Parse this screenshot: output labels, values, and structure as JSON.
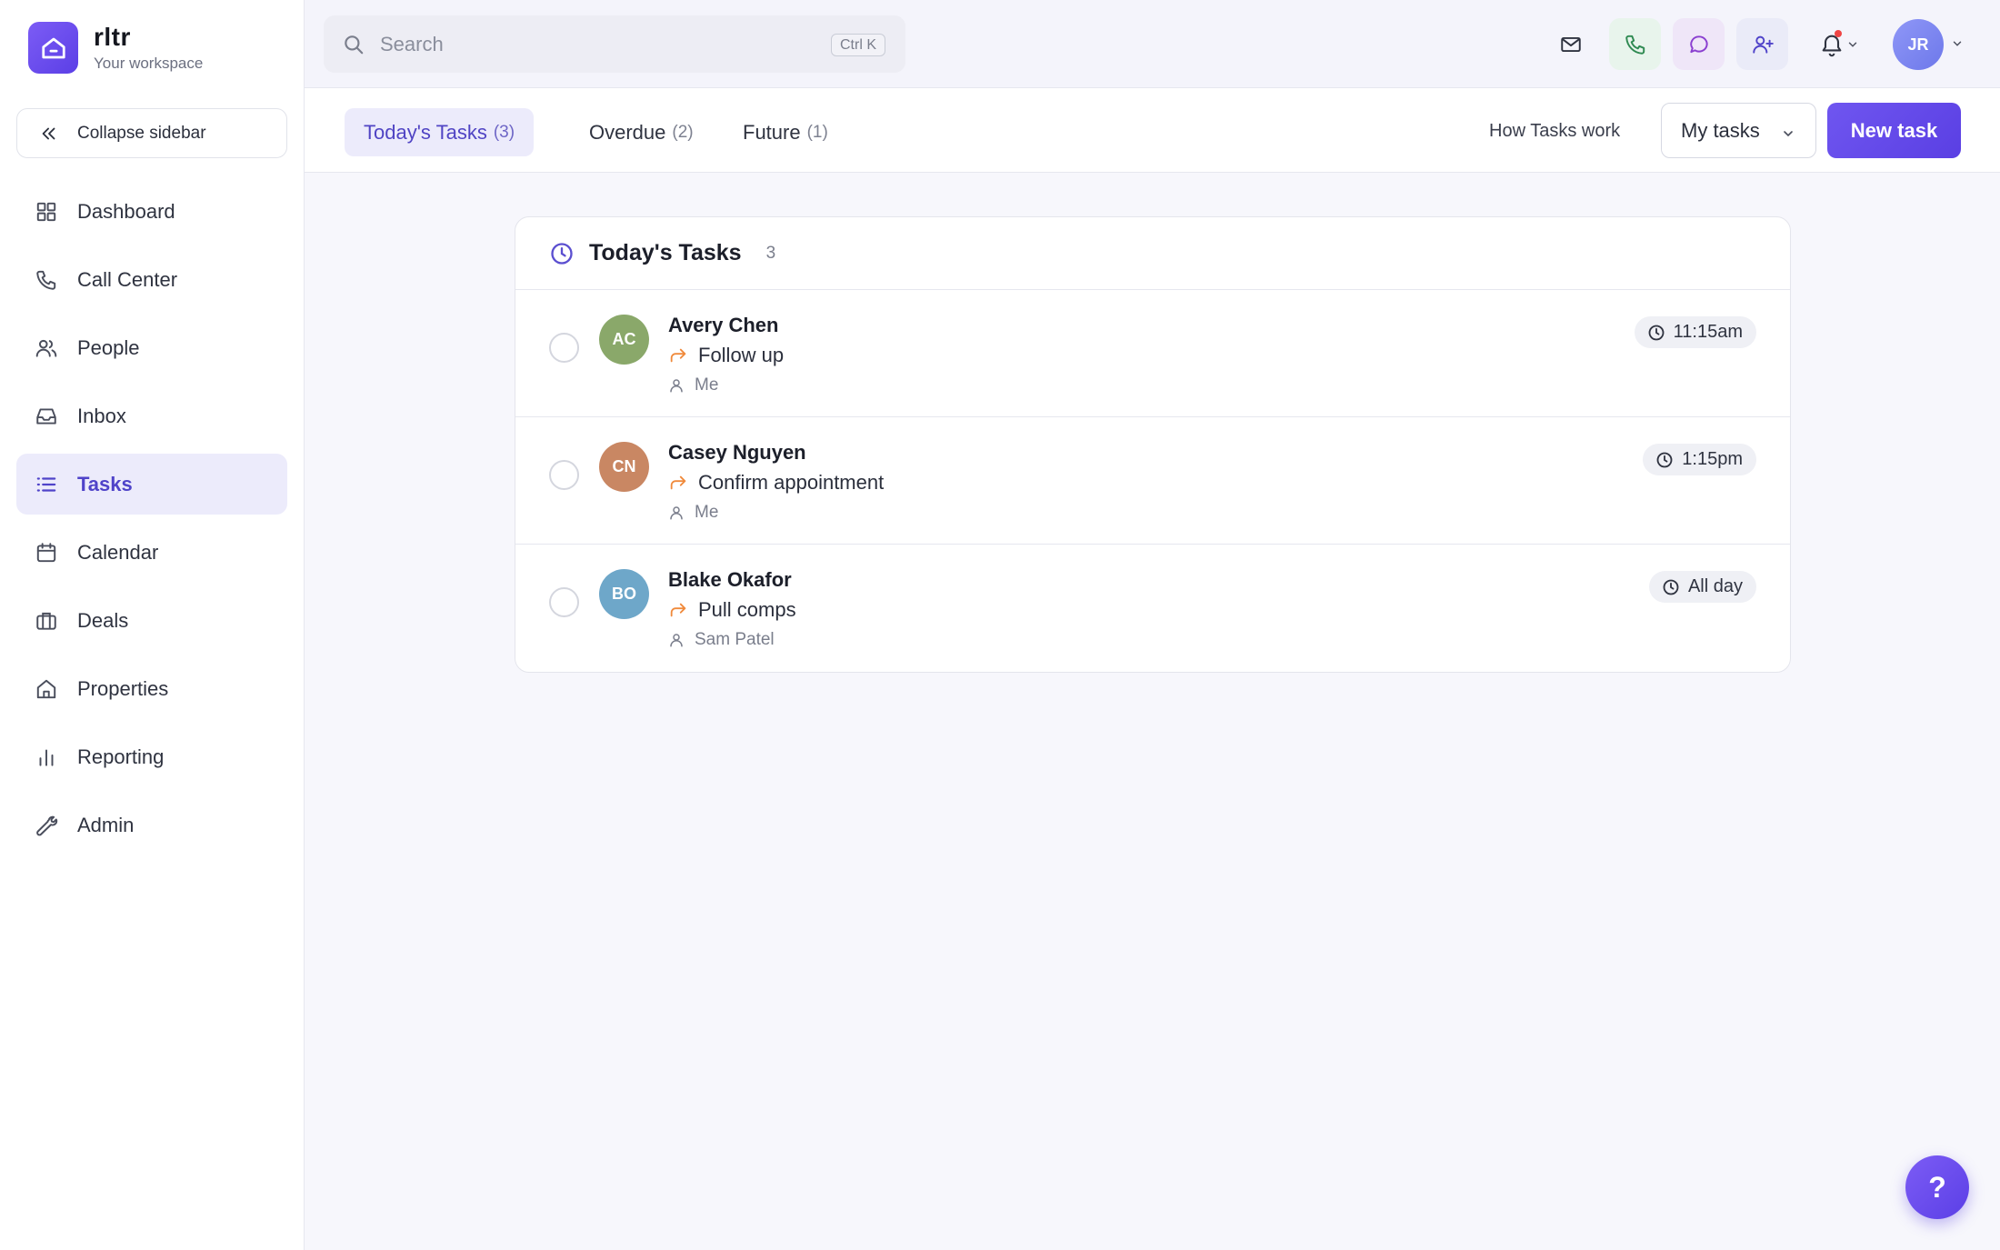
{
  "brand": {
    "name": "rltr",
    "subtitle": "Your workspace",
    "logo_icon": "house-icon"
  },
  "sidebar": {
    "collapse_label": "Collapse sidebar",
    "items": [
      {
        "label": "Dashboard",
        "icon": "grid-icon",
        "active": false
      },
      {
        "label": "Call Center",
        "icon": "phone-icon",
        "active": false
      },
      {
        "label": "People",
        "icon": "users-icon",
        "active": false
      },
      {
        "label": "Inbox",
        "icon": "inbox-icon",
        "active": false
      },
      {
        "label": "Tasks",
        "icon": "list-icon",
        "active": true
      },
      {
        "label": "Calendar",
        "icon": "calendar-icon",
        "active": false
      },
      {
        "label": "Deals",
        "icon": "briefcase-icon",
        "active": false
      },
      {
        "label": "Properties",
        "icon": "home-icon",
        "active": false
      },
      {
        "label": "Reporting",
        "icon": "bar-chart-icon",
        "active": false
      },
      {
        "label": "Admin",
        "icon": "wrench-icon",
        "active": false
      }
    ]
  },
  "search": {
    "placeholder": "Search",
    "shortcut": "Ctrl K"
  },
  "header": {
    "user_initials": "JR"
  },
  "tabs": [
    {
      "label": "Today's Tasks",
      "count": "(3)",
      "active": true
    },
    {
      "label": "Overdue",
      "count": "(2)",
      "active": false
    },
    {
      "label": "Future",
      "count": "(1)",
      "active": false
    }
  ],
  "actions": {
    "how_link": "How Tasks work",
    "filter_label": "My tasks",
    "new_task_label": "New task"
  },
  "card": {
    "title": "Today's Tasks",
    "count": "3",
    "tasks": [
      {
        "initials": "AC",
        "name": "Avery Chen",
        "type": "Follow up",
        "assignee": "Me",
        "time": "11:15am",
        "avatar_color": "#8aa86a"
      },
      {
        "initials": "CN",
        "name": "Casey Nguyen",
        "type": "Confirm appointment",
        "assignee": "Me",
        "time": "1:15pm",
        "avatar_color": "#c98763"
      },
      {
        "initials": "BO",
        "name": "Blake Okafor",
        "type": "Pull comps",
        "assignee": "Sam Patel",
        "time": "All day",
        "avatar_color": "#6ea7c9"
      }
    ]
  },
  "help": {
    "label": "?"
  },
  "colors": {
    "accent": "#5b3fe6",
    "active_bg": "#ecebfb",
    "task_arrow": "#f08a3c",
    "notification_dot": "#ef4444"
  }
}
